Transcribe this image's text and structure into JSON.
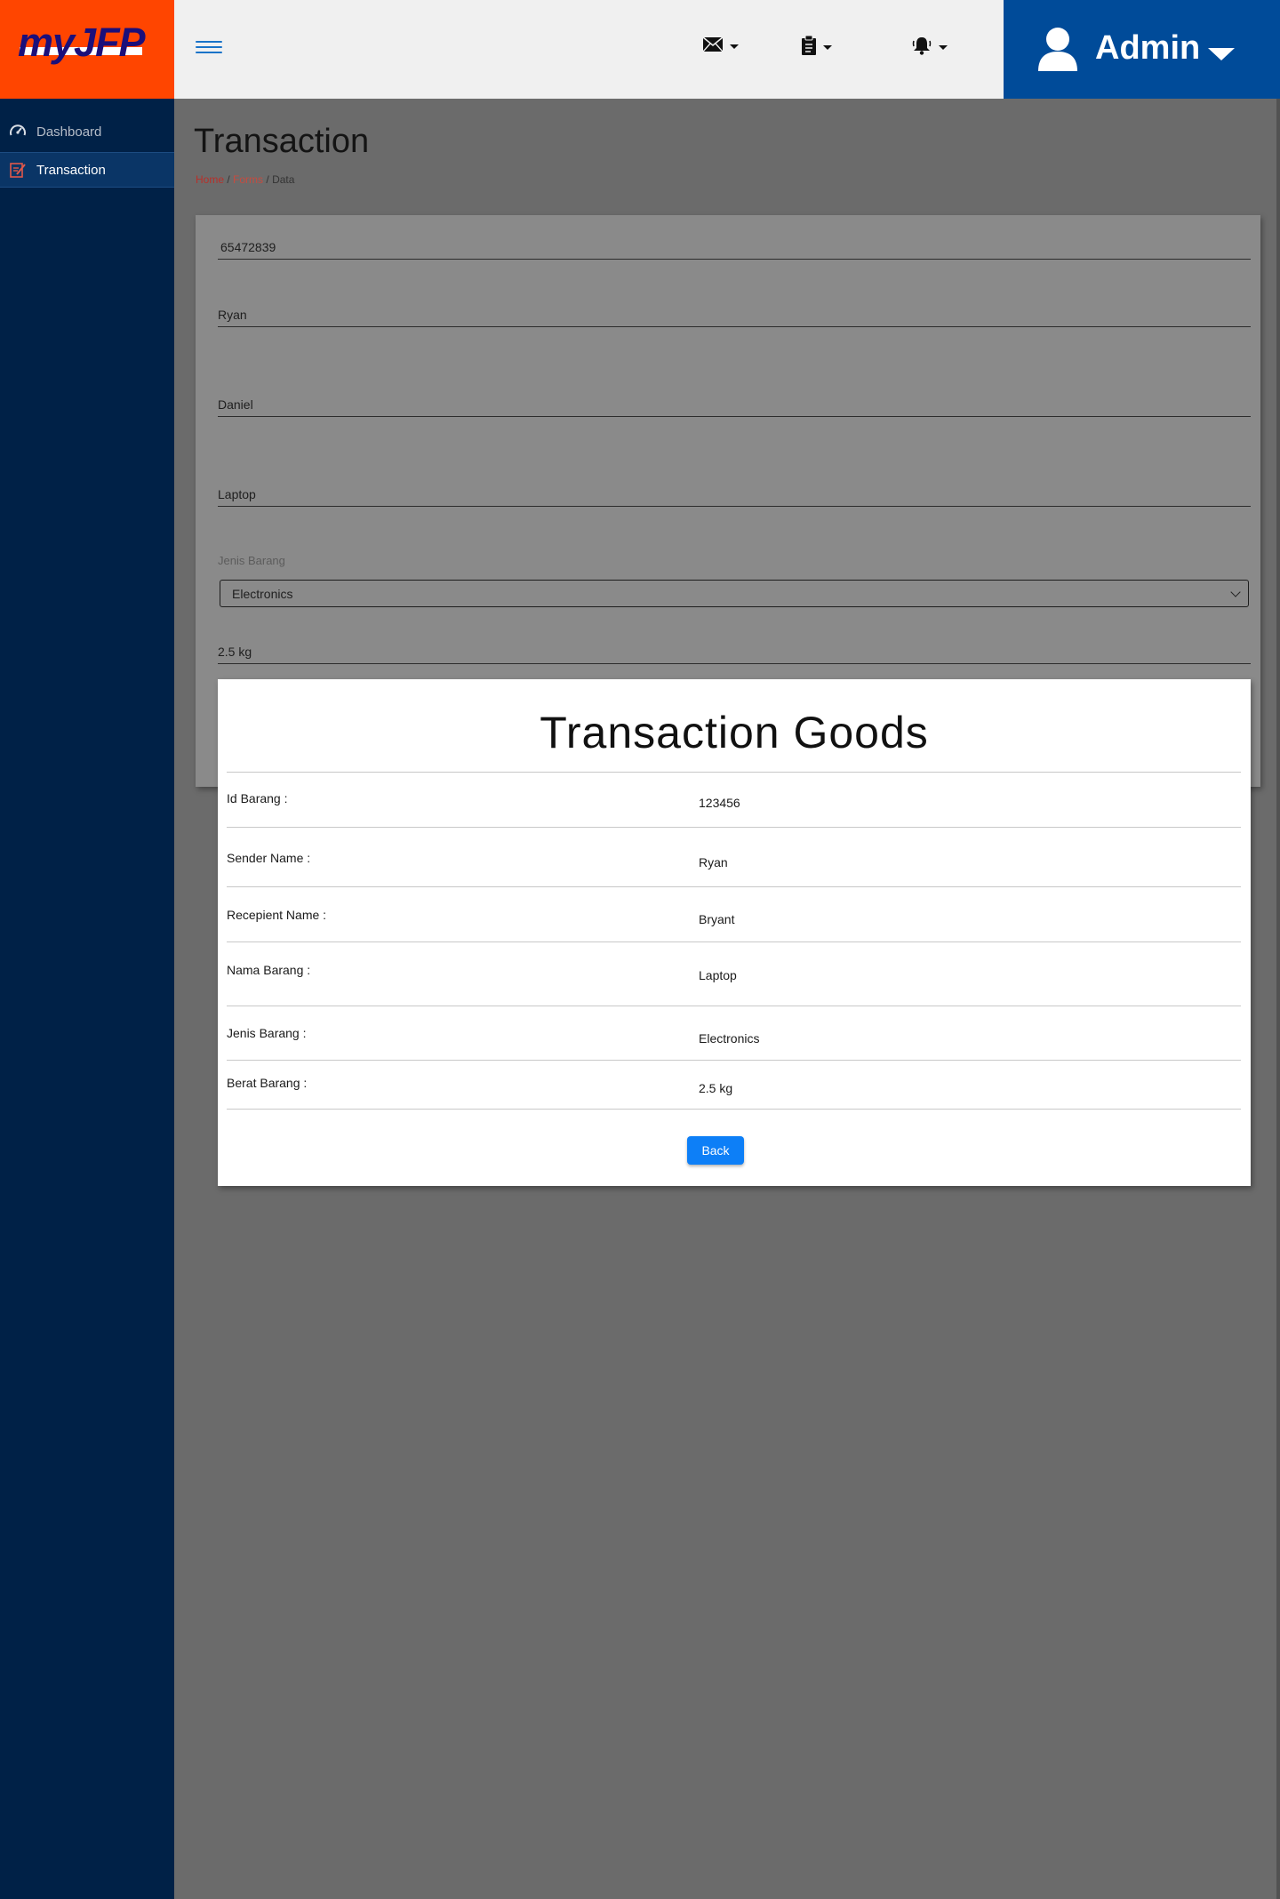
{
  "logo": {
    "text": "myJFP"
  },
  "sidebar": {
    "items": [
      {
        "label": "Dashboard",
        "icon": "speedometer-icon"
      },
      {
        "label": "Transaction",
        "icon": "edit-document-icon"
      }
    ]
  },
  "header": {
    "icons": [
      "mail-icon",
      "clipboard-icon",
      "bell-icon"
    ],
    "user": {
      "name": "Admin",
      "icon": "user-icon"
    }
  },
  "page": {
    "title": "Transaction",
    "breadcrumb": {
      "home": "Home",
      "forms": "Forms",
      "current": "Data",
      "sep": "/"
    }
  },
  "form": {
    "id_barang": "65472839",
    "sender": "Ryan",
    "recipient": "Daniel",
    "nama_barang": "Laptop",
    "jenis_label": "Jenis Barang",
    "jenis_value": "Electronics",
    "berat": "2.5 kg"
  },
  "modal": {
    "title": "Transaction Goods",
    "rows": [
      {
        "label": "Id Barang :",
        "value": "123456"
      },
      {
        "label": "Sender Name :",
        "value": "Ryan"
      },
      {
        "label": "Recepient Name :",
        "value": "Bryant"
      },
      {
        "label": "Nama Barang :",
        "value": "Laptop"
      },
      {
        "label": "Jenis Barang :",
        "value": "Electronics"
      },
      {
        "label": "Berat Barang :",
        "value": "2.5 kg"
      }
    ],
    "back_label": "Back"
  },
  "colors": {
    "sidebar_bg": "#002147",
    "logo_bg": "#ff4500",
    "admin_bg": "#004b99",
    "button_bg": "#0d7ff7",
    "overlay_bg": "#6b6b6b"
  }
}
